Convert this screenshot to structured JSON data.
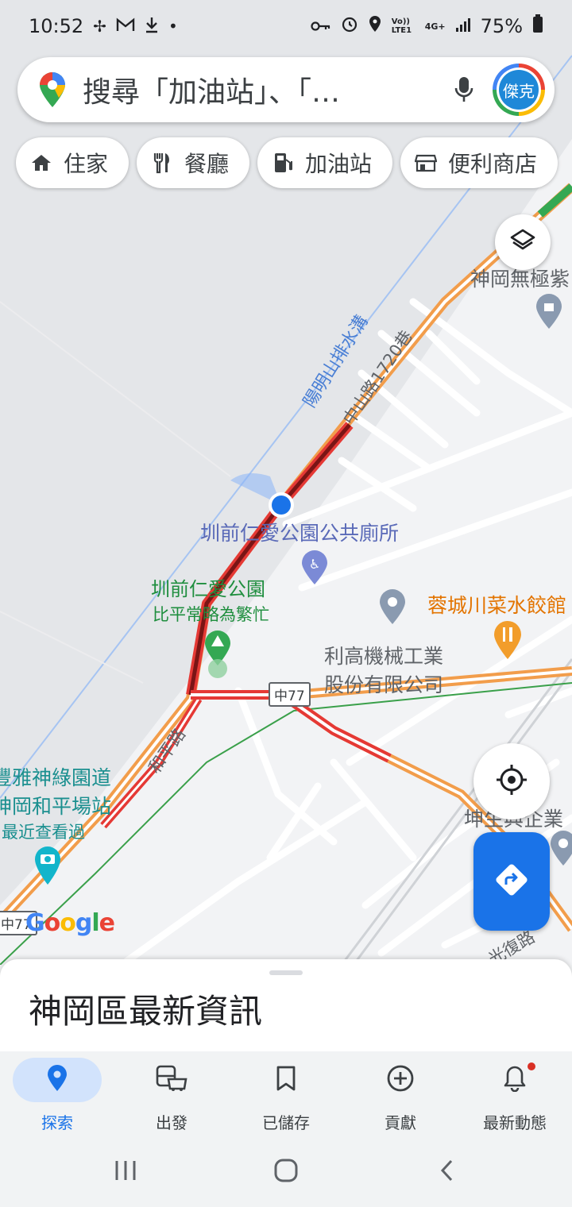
{
  "status_bar": {
    "time": "10:52",
    "left_icons": [
      "fan-icon",
      "gmail-icon",
      "download-icon",
      "dot-icon"
    ],
    "right_icons": [
      "vpn-key-icon",
      "alarm-icon",
      "location-icon",
      "volte-icon",
      "4g-icon",
      "signal-icon",
      "battery-icon"
    ],
    "volte_text": "Vo)) LTE1",
    "net_text": "4G+",
    "battery": "75%"
  },
  "search": {
    "query": "搜尋「加油站」、「…",
    "avatar_text": "傑克"
  },
  "chips": [
    {
      "label": "住家",
      "icon": "home-icon"
    },
    {
      "label": "餐廳",
      "icon": "restaurant-icon"
    },
    {
      "label": "加油站",
      "icon": "gas-station-icon"
    },
    {
      "label": "便利商店",
      "icon": "store-icon"
    }
  ],
  "map": {
    "labels": {
      "drain": "陽明山排水溝",
      "lane": "中山路1720巷",
      "toilet": "圳前仁愛公園公共廁所",
      "park": "圳前仁愛公園",
      "park_status": "比平常略為繁忙",
      "restaurant": "蓉城川菜水餃館",
      "company_1": "利高機械工業",
      "company_2": "股份有限公司",
      "temple": "神岡無極紫",
      "greenway_1": "豐雅神綠園道",
      "greenway_2": "神岡和平場站",
      "greenway_3": "最近查看過",
      "heping_road": "和平路",
      "kunsheng": "坤生興企業",
      "guangfu": "光復路",
      "route_shield_1": "中77",
      "route_shield_2": "中77"
    },
    "google_logo": [
      "G",
      "o",
      "o",
      "g",
      "l",
      "e"
    ]
  },
  "sheet": {
    "title": "神岡區最新資訊"
  },
  "bottom_nav": [
    {
      "label": "探索",
      "icon": "explore-pin-icon",
      "active": true
    },
    {
      "label": "出發",
      "icon": "commute-icon",
      "active": false
    },
    {
      "label": "已儲存",
      "icon": "bookmark-icon",
      "active": false
    },
    {
      "label": "貢獻",
      "icon": "add-circle-icon",
      "active": false
    },
    {
      "label": "最新動態",
      "icon": "bell-icon",
      "active": false,
      "badge": true
    }
  ],
  "colors": {
    "accent": "#1a73e8",
    "traffic_red": "#e53935",
    "traffic_dark_red": "#8b1a1a",
    "traffic_orange": "#f29d4b"
  }
}
